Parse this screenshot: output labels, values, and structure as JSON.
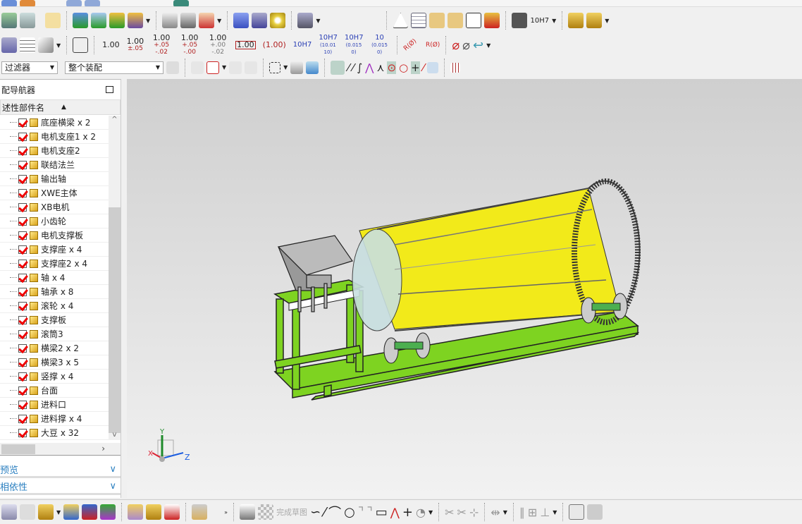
{
  "toolbar": {
    "dimensions": [
      {
        "main": "1.00",
        "tol": ""
      },
      {
        "main": "1.00",
        "tol": "±.05"
      },
      {
        "main": "1.00",
        "tol": "+.05 -.02"
      },
      {
        "main": "1.00",
        "tol": "+.05 -.00"
      },
      {
        "main": "1.00",
        "tol": "+.00 -.02"
      },
      {
        "main": "1.00",
        "tol": "boxed"
      },
      {
        "main": "(1.00)",
        "tol": ""
      },
      {
        "main": "10H7",
        "tol": ""
      },
      {
        "main": "10H7",
        "tol": "(10.01 10)"
      },
      {
        "main": "10H7",
        "tol": "(0.015 0)"
      },
      {
        "main": "10",
        "tol": "(0.015 0)"
      }
    ],
    "fit_label": "10H7",
    "radius_labels": [
      "R(Ø)",
      "R(Ø)"
    ],
    "filter_select": "过滤器",
    "scope_select": "整个装配"
  },
  "navigator": {
    "title": "配导航器",
    "column_header": "述性部件名",
    "items": [
      "底座横梁 x 2",
      "电机支座1 x 2",
      "电机支座2",
      "联结法兰",
      "输出轴",
      "XWE主体",
      "XB电机",
      "小齿轮",
      "电机支撑板",
      "支撑座 x 4",
      "支撑座2 x 4",
      "轴 x 4",
      "轴承 x 8",
      "滚轮 x 4",
      "支撑板",
      "滚筒3",
      "横梁2 x 2",
      "横梁3 x 5",
      "竖撑 x 4",
      "台面",
      "进料口",
      "进料撑 x 4",
      "大豆 x 32"
    ],
    "sections": [
      "预览",
      "相依性"
    ]
  },
  "triad": {
    "x": "X",
    "y": "Y",
    "z": "Z"
  },
  "bottom_toolbar": {
    "finish_sketch": "完成草图"
  },
  "colors": {
    "frame": "#7ed321",
    "drum": "#f2ea1a",
    "accent": "#2a7fc0"
  }
}
